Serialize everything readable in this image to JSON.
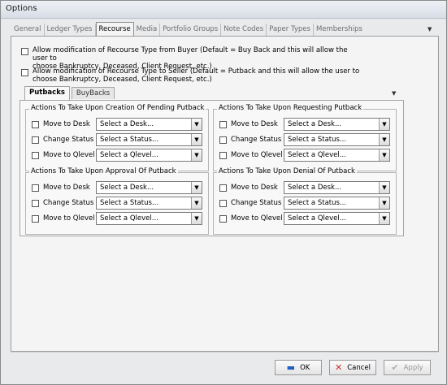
{
  "window": {
    "title": "Options"
  },
  "tabs": [
    "General",
    "Ledger Types",
    "Recourse",
    "Media",
    "Portfolio Groups",
    "Note Codes",
    "Paper Types",
    "Memberships"
  ],
  "permissions": [
    {
      "label_line1": "Allow modification of Recourse Type from Buyer (Default = Buy Back and this will allow the user to",
      "label_line2": "choose Bankruptcy, Deceased, Client Request, etc.)",
      "checked": false
    },
    {
      "label_line1": "Allow modification of Recourse Type to Seller (Default = Putback and this will allow the user to",
      "label_line2": "choose Bankruptcy, Deceased, Client Request, etc.)",
      "checked": false
    }
  ],
  "subtabs": [
    "Putbacks",
    "BuyBacks"
  ],
  "groups": [
    {
      "title": "Actions To Take Upon Creation Of Pending Putback",
      "rows": [
        {
          "label": "Move to Desk",
          "value": "Select a Desk..."
        },
        {
          "label": "Change Status",
          "value": "Select a Status..."
        },
        {
          "label": "Move to Qlevel",
          "value": "Select a Qlevel..."
        }
      ]
    },
    {
      "title": "Actions To Take Upon Requesting Putback",
      "rows": [
        {
          "label": "Move to Desk",
          "value": "Select a Desk..."
        },
        {
          "label": "Change Status",
          "value": "Select a Status..."
        },
        {
          "label": "Move to Qlevel",
          "value": "Select a Qlevel..."
        }
      ]
    },
    {
      "title": "Actions To Take Upon Approval Of Putback",
      "rows": [
        {
          "label": "Move to Desk",
          "value": "Select a Desk..."
        },
        {
          "label": "Change Status",
          "value": "Select a Status..."
        },
        {
          "label": "Move to Qlevel",
          "value": "Select a Qlevel..."
        }
      ]
    },
    {
      "title": "Actions To Take Upon Denial Of Putback",
      "rows": [
        {
          "label": "Move to Desk",
          "value": "Select a Desk..."
        },
        {
          "label": "Change Status",
          "value": "Select a Status..."
        },
        {
          "label": "Move to Qlevel",
          "value": "Select a Qlevel..."
        }
      ]
    }
  ],
  "footer": {
    "ok": "OK",
    "cancel": "Cancel",
    "apply": "Apply"
  },
  "icons": {
    "ok": "save-icon",
    "cancel": "cancel-x-icon",
    "apply": "checkmark-icon",
    "dropdown": "chevron-down-icon"
  }
}
